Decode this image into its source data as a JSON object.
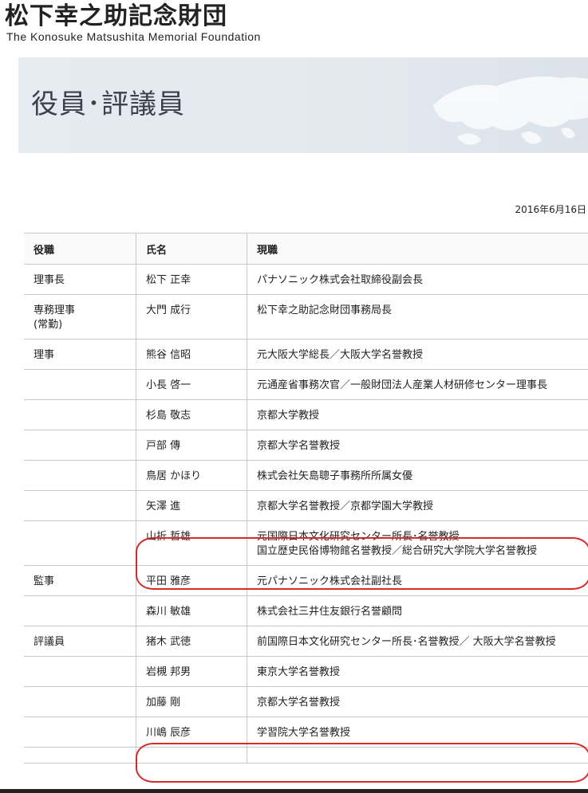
{
  "logo": {
    "jp": "松下幸之助記念財団",
    "en": "The Konosuke Matsushita Memorial Foundation"
  },
  "hero": {
    "title": "役員･評議員"
  },
  "date": "2016年6月16日",
  "table": {
    "headers": [
      "役職",
      "氏名",
      "現職"
    ],
    "rows": [
      {
        "role": "理事長",
        "name": "松下 正幸",
        "position": "パナソニック株式会社取締役副会長"
      },
      {
        "role": "専務理事\n(常勤)",
        "name": "大門 成行",
        "position": "松下幸之助記念財団事務局長"
      },
      {
        "role": "理事",
        "name": "熊谷 信昭",
        "position": "元大阪大学総長／大阪大学名誉教授"
      },
      {
        "role": "",
        "name": "小長 啓一",
        "position": "元通産省事務次官／一般財団法人産業人材研修センター理事長"
      },
      {
        "role": "",
        "name": "杉島 敬志",
        "position": "京都大学教授"
      },
      {
        "role": "",
        "name": "戸部 傳",
        "position": "京都大学名誉教授"
      },
      {
        "role": "",
        "name": "鳥居 かほり",
        "position": "株式会社矢島聰子事務所所属女優"
      },
      {
        "role": "",
        "name": "矢澤 進",
        "position": "京都大学名誉教授／京都学園大学教授"
      },
      {
        "role": "",
        "name": "山折 哲雄",
        "position": "元国際日本文化研究センター所長･名誉教授\n国立歴史民俗博物館名誉教授／総合研究大学院大学名誉教授"
      },
      {
        "role": "監事",
        "name": "平田 雅彦",
        "position": "元パナソニック株式会社副社長"
      },
      {
        "role": "",
        "name": "森川 敏雄",
        "position": "株式会社三井住友銀行名誉顧問"
      },
      {
        "role": "評議員",
        "name": "猪木 武徳",
        "position": "前国際日本文化研究センター所長･名誉教授／ 大阪大学名誉教授"
      },
      {
        "role": "",
        "name": "岩槻 邦男",
        "position": "東京大学名誉教授"
      },
      {
        "role": "",
        "name": "加藤 剛",
        "position": "京都大学名誉教授"
      },
      {
        "role": "",
        "name": "川嶋 辰彦",
        "position": "学習院大学名誉教授"
      },
      {
        "role": "",
        "name": "",
        "position": ""
      }
    ]
  }
}
